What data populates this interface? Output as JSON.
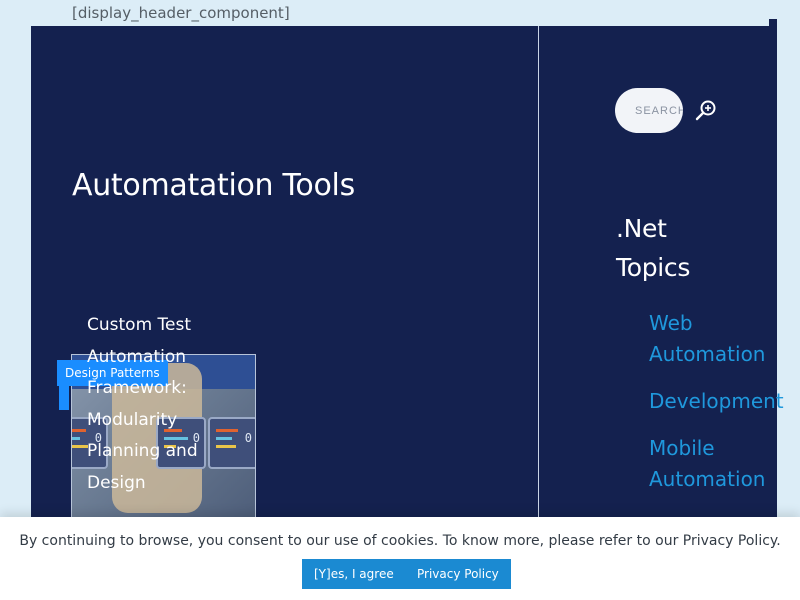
{
  "shortcode_text": "[display_header_component]",
  "main": {
    "section_title": "Automatation Tools",
    "post": {
      "category": "Design Patterns",
      "title": "Custom Test Automation Framework: Modularity Planning and Design"
    }
  },
  "sidebar": {
    "search": {
      "placeholder": "SEARCH"
    },
    "topics_heading": ".Net Topics",
    "topics": [
      {
        "label": "Web Automation"
      },
      {
        "label": "Development"
      },
      {
        "label": "Mobile Automation"
      }
    ]
  },
  "cookie": {
    "message": "By continuing to browse, you consent to our use of cookies. To know more, please refer to our Privacy Policy.",
    "agree_label": "[Y]es, I agree",
    "policy_label": "Privacy Policy"
  },
  "thumbnail_numbers": [
    "0",
    "0",
    "0"
  ],
  "colors": {
    "page_bg": "#dcedf7",
    "panel_bg": "#14214f",
    "link": "#1f98dc",
    "badge": "#1a8dff",
    "button": "#1b8ad2"
  },
  "icons": {
    "search": "search-icon"
  }
}
